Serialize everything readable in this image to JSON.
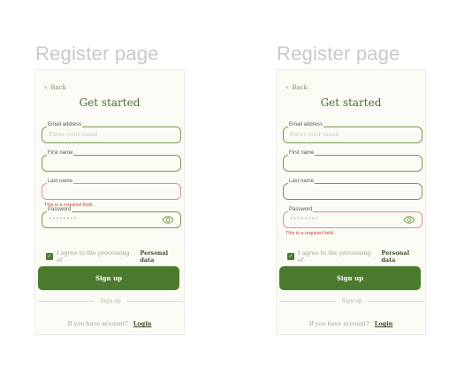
{
  "screens": [
    {
      "page_title": "Register page",
      "back_label": "Back",
      "heading": "Get started",
      "fields": {
        "email": {
          "label": "Email address",
          "placeholder": "Enter your email"
        },
        "first_name": {
          "label": "First name"
        },
        "last_name": {
          "label": "Last name",
          "error": "This is a required field."
        },
        "password": {
          "label": "Password",
          "value": "••••••••"
        }
      },
      "agree_text": "I agree to the processing of",
      "agree_link": "Personal data",
      "signup_button": "Sign up",
      "divider_text": "Sign up",
      "footer_text": "If you have account?",
      "footer_link": "Login"
    },
    {
      "page_title": "Register page",
      "back_label": "Back",
      "heading": "Get started",
      "fields": {
        "email": {
          "label": "Email address",
          "placeholder": "Enter your email"
        },
        "first_name": {
          "label": "First name"
        },
        "last_name": {
          "label": "Last name"
        },
        "password": {
          "label": "Password",
          "value": "••••••••",
          "error": "This is a required field."
        }
      },
      "agree_text": "I agree to the processing of",
      "agree_link": "Personal data",
      "signup_button": "Sign up",
      "divider_text": "Sign up",
      "footer_text": "If you have account?",
      "footer_link": "Login"
    }
  ],
  "icons": {
    "back": "chevron-left-icon",
    "password_toggle": "eye-icon",
    "checkbox": "checkmark-icon"
  },
  "colors": {
    "primary": "#4b7a2e",
    "border": "#7a9a4e",
    "error_border": "#e2908a",
    "error_text": "#d33b2f",
    "background": "#fbfbf6"
  }
}
